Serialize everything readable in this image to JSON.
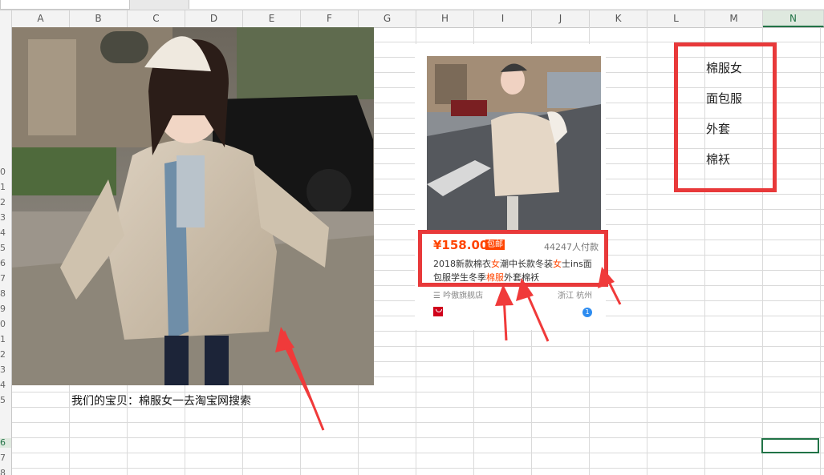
{
  "columns": [
    "A",
    "B",
    "C",
    "D",
    "E",
    "F",
    "G",
    "H",
    "I",
    "J",
    "K",
    "L",
    "M",
    "N"
  ],
  "selected_column": "N",
  "row_numbers": [
    "0",
    "1",
    "2",
    "3",
    "4",
    "5",
    "6",
    "7",
    "8",
    "9",
    "0",
    "1",
    "2",
    "3",
    "4",
    "5",
    "6",
    "7",
    "8",
    "9"
  ],
  "selected_row_index": 16,
  "product": {
    "price": "¥158.00",
    "badge": "包邮",
    "paid_count": "44247人付款",
    "title_parts": [
      "2018新款棉衣",
      "女",
      "潮中长款冬装",
      "女",
      "士ins面包服学生冬季",
      "棉服",
      "外套棉袄"
    ],
    "shop": "☰ 吟傲旗舰店",
    "location": "浙江 杭州"
  },
  "keywords": [
    "棉服女",
    "面包服",
    "外套",
    "棉袄"
  ],
  "caption": "我们的宝贝：棉服女一去淘宝网搜索",
  "colors": {
    "annotation_red": "#e8393a",
    "taobao_orange": "#ff4400",
    "excel_green": "#217346"
  }
}
